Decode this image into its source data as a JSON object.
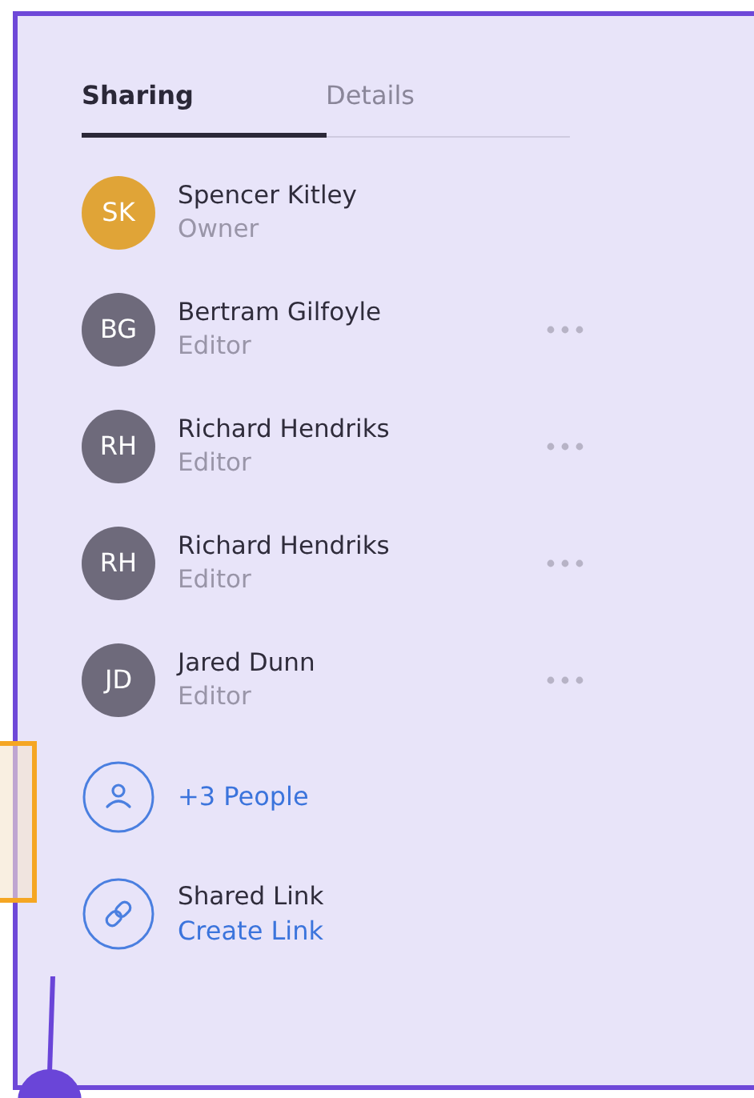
{
  "tabs": [
    {
      "label": "Sharing",
      "selected": true
    },
    {
      "label": "Details",
      "selected": false
    }
  ],
  "people": [
    {
      "initials": "SK",
      "name": "Spencer Kitley",
      "role": "Owner",
      "color": "#e0a437",
      "menu": false
    },
    {
      "initials": "BG",
      "name": "Bertram Gilfoyle",
      "role": "Editor",
      "color": "#6e6a7b",
      "menu": true
    },
    {
      "initials": "RH",
      "name": "Richard Hendriks",
      "role": "Editor",
      "color": "#6e6a7b",
      "menu": true
    },
    {
      "initials": "RH",
      "name": "Richard Hendriks",
      "role": "Editor",
      "color": "#6e6a7b",
      "menu": true
    },
    {
      "initials": "JD",
      "name": "Jared Dunn",
      "role": "Editor",
      "color": "#6e6a7b",
      "menu": true
    }
  ],
  "more_people": {
    "label": "+3 People"
  },
  "shared_link": {
    "title": "Shared Link",
    "action": "Create Link"
  }
}
